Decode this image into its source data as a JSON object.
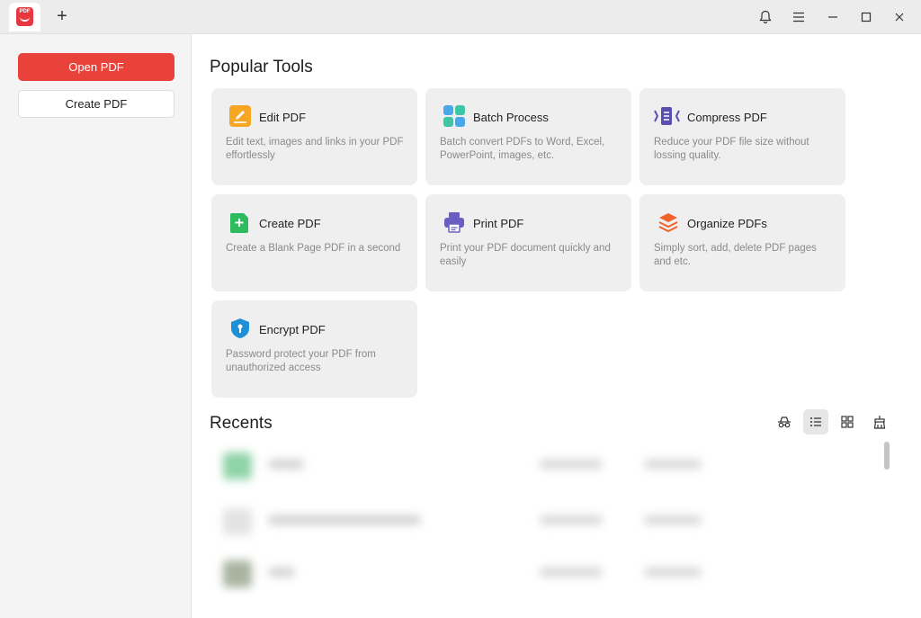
{
  "titlebar": {
    "app_logo_text": "PDF",
    "new_tab_glyph": "+",
    "controls": [
      "bell-icon",
      "menu-icon",
      "minimize-icon",
      "maximize-icon",
      "close-icon"
    ]
  },
  "sidebar": {
    "open_pdf_label": "Open PDF",
    "create_pdf_label": "Create PDF"
  },
  "popular_tools": {
    "title": "Popular Tools",
    "tools": [
      {
        "title": "Edit PDF",
        "desc": "Edit text, images and links in your PDF effortlessly",
        "icon": "edit-icon"
      },
      {
        "title": "Batch Process",
        "desc": "Batch convert PDFs to Word, Excel, PowerPoint, images, etc.",
        "icon": "batch-icon"
      },
      {
        "title": "Compress PDF",
        "desc": "Reduce your PDF file size without lossing quality.",
        "icon": "compress-icon"
      },
      {
        "title": "Create PDF",
        "desc": "Create a Blank Page PDF in a second",
        "icon": "create-icon"
      },
      {
        "title": "Print PDF",
        "desc": "Print your PDF document quickly and easily",
        "icon": "printer-icon"
      },
      {
        "title": "Organize PDFs",
        "desc": "Simply sort, add, delete PDF pages and etc.",
        "icon": "layers-icon"
      },
      {
        "title": "Encrypt PDF",
        "desc": "Password protect your PDF from unauthorized access",
        "icon": "shield-icon"
      }
    ]
  },
  "recents": {
    "title": "Recents",
    "view_controls": [
      "incognito-icon",
      "list-view-icon",
      "grid-view-icon",
      "clean-icon"
    ],
    "active_view": "list"
  },
  "colors": {
    "accent": "#e9423b",
    "card_bg": "#efefef",
    "sidebar_bg": "#f4f4f4"
  }
}
